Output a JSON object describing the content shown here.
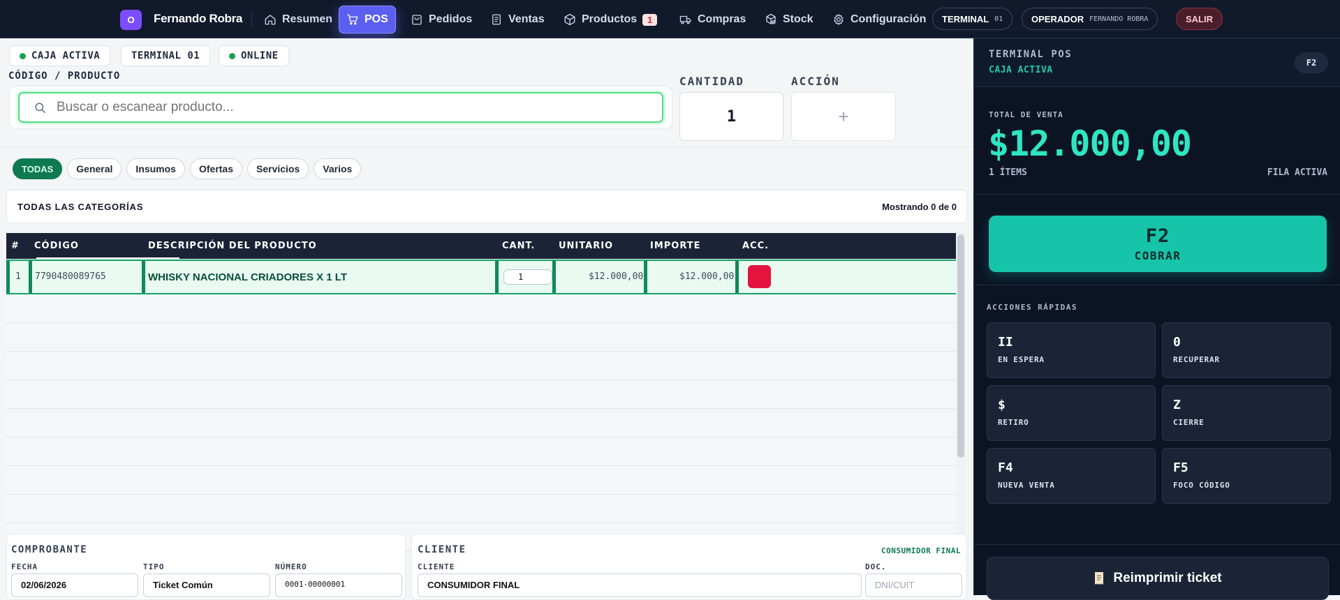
{
  "nav": {
    "avatar_letter": "O",
    "user_name": "Fernando Robra",
    "items": [
      {
        "label": "Resumen",
        "icon": "home-icon"
      },
      {
        "label": "POS",
        "icon": "cart-icon",
        "active": true
      },
      {
        "label": "Pedidos",
        "icon": "bag-icon"
      },
      {
        "label": "Ventas",
        "icon": "document-icon"
      },
      {
        "label": "Productos",
        "icon": "box-icon",
        "badge": "1"
      },
      {
        "label": "Compras",
        "icon": "truck-icon"
      },
      {
        "label": "Stock",
        "icon": "boxes-icon"
      },
      {
        "label": "Configuración",
        "icon": "gear-icon"
      }
    ],
    "terminal": {
      "label": "TERMINAL",
      "value": "01"
    },
    "operator": {
      "label": "OPERADOR",
      "value": "FERNANDO ROBRA"
    },
    "exit_label": "SALIR"
  },
  "status": {
    "caja": "CAJA ACTIVA",
    "terminal": "TERMINAL 01",
    "online": "ONLINE"
  },
  "entry": {
    "code_label": "CÓDIGO / PRODUCTO",
    "search_placeholder": "Buscar o escanear producto...",
    "qty_label": "CANTIDAD",
    "qty_value": "1",
    "action_label": "ACCIÓN",
    "action_symbol": "+"
  },
  "categories": [
    "TODAS",
    "General",
    "Insumos",
    "Ofertas",
    "Servicios",
    "Varios"
  ],
  "category_bar": {
    "title": "TODAS LAS CATEGORÍAS",
    "count": "Mostrando 0 de 0"
  },
  "table": {
    "headers": [
      "#",
      "CÓDIGO",
      "DESCRIPCIÓN DEL PRODUCTO",
      "CANT.",
      "UNITARIO",
      "IMPORTE",
      "ACC."
    ],
    "rows": [
      {
        "num": "1",
        "code": "7790480089765",
        "description": "WHISKY NACIONAL CRIADORES X 1 LT",
        "qty": "1",
        "unit": "$12.000,00",
        "amount": "$12.000,00"
      }
    ]
  },
  "voucher": {
    "title": "COMPROBANTE",
    "date_label": "FECHA",
    "date_value": "02/06/2026",
    "type_label": "TIPO",
    "type_value": "Ticket Común",
    "number_label": "NÚMERO",
    "number_value": "0001-00000001"
  },
  "client": {
    "title": "CLIENTE",
    "tag": "CONSUMIDOR FINAL",
    "client_label": "CLIENTE",
    "client_value": "CONSUMIDOR FINAL",
    "doc_label": "DOC.",
    "doc_placeholder": "DNI/CUIT"
  },
  "sidebar": {
    "title": "TERMINAL POS",
    "subtitle": "CAJA ACTIVA",
    "key": "F2",
    "total_label": "TOTAL DE VENTA",
    "total_value": "$12.000,00",
    "items_count": "1 ÍTEMS",
    "row_status": "FILA ACTIVA",
    "pay_key": "F2",
    "pay_label": "COBRAR",
    "quick_title": "ACCIONES RÁPIDAS",
    "quick_actions": [
      {
        "key": "II",
        "label": "EN ESPERA"
      },
      {
        "key": "0",
        "label": "RECUPERAR"
      },
      {
        "key": "$",
        "label": "RETIRO"
      },
      {
        "key": "Z",
        "label": "CIERRE"
      },
      {
        "key": "F4",
        "label": "NUEVA VENTA"
      },
      {
        "key": "F5",
        "label": "FOCO CÓDIGO"
      }
    ],
    "reprint_label": "Reimprimir ticket"
  },
  "colors": {
    "nav_bg": "#111a2b",
    "accent_active": "#5b5ff0",
    "success_green": "#16a34a",
    "total_teal": "#2ee6c2",
    "pay_button": "#16c4aa",
    "delete_red": "#e4143e"
  }
}
